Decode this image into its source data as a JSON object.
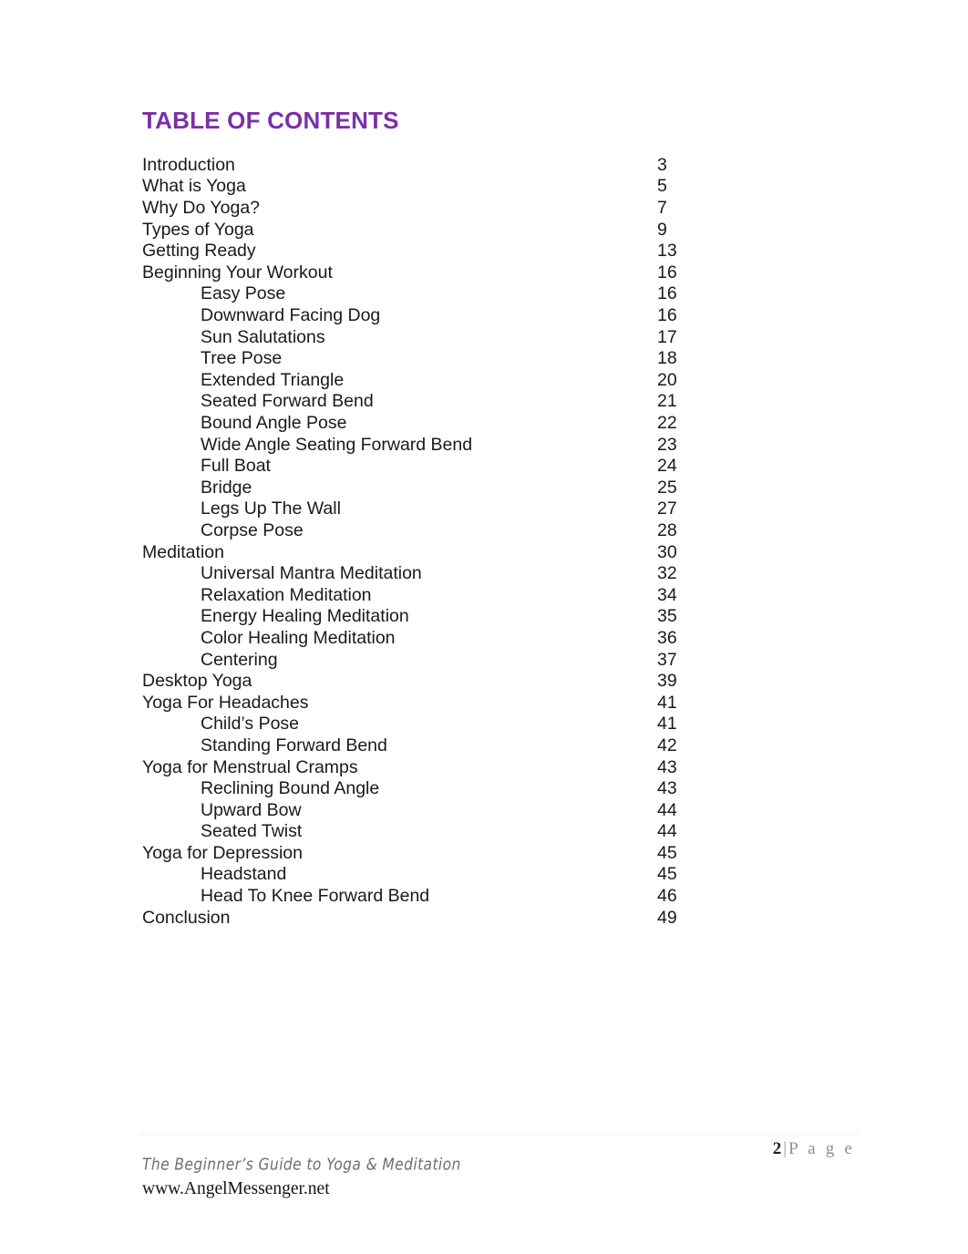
{
  "document": {
    "heading": "TABLE OF CONTENTS",
    "accent_color": "#7B2FA8"
  },
  "toc": {
    "entries": [
      {
        "title": "Introduction",
        "page": "3",
        "level": 0
      },
      {
        "title": "What is Yoga",
        "page": "5",
        "level": 0
      },
      {
        "title": "Why Do Yoga?",
        "page": "7",
        "level": 0
      },
      {
        "title": "Types of Yoga",
        "page": "9",
        "level": 0
      },
      {
        "title": "Getting Ready",
        "page": "13",
        "level": 0
      },
      {
        "title": "Beginning Your Workout",
        "page": "16",
        "level": 0
      },
      {
        "title": "Easy Pose",
        "page": "16",
        "level": 1
      },
      {
        "title": "Downward Facing Dog",
        "page": "16",
        "level": 1
      },
      {
        "title": "Sun Salutations",
        "page": "17",
        "level": 1
      },
      {
        "title": "Tree Pose",
        "page": "18",
        "level": 1
      },
      {
        "title": "Extended Triangle",
        "page": "20",
        "level": 1
      },
      {
        "title": "Seated Forward Bend",
        "page": "21",
        "level": 1
      },
      {
        "title": "Bound Angle Pose",
        "page": "22",
        "level": 1
      },
      {
        "title": "Wide Angle Seating Forward Bend",
        "page": "23",
        "level": 1
      },
      {
        "title": "Full Boat",
        "page": "24",
        "level": 1
      },
      {
        "title": "Bridge",
        "page": "25",
        "level": 1
      },
      {
        "title": "Legs Up The Wall",
        "page": "27",
        "level": 1
      },
      {
        "title": "Corpse Pose",
        "page": "28",
        "level": 1
      },
      {
        "title": "Meditation",
        "page": "30",
        "level": 0
      },
      {
        "title": "Universal Mantra Meditation",
        "page": "32",
        "level": 1
      },
      {
        "title": "Relaxation Meditation",
        "page": "34",
        "level": 1
      },
      {
        "title": "Energy Healing Meditation",
        "page": "35",
        "level": 1
      },
      {
        "title": "Color Healing Meditation",
        "page": "36",
        "level": 1
      },
      {
        "title": "Centering",
        "page": "37",
        "level": 1
      },
      {
        "title": "Desktop Yoga",
        "page": "39",
        "level": 0
      },
      {
        "title": "Yoga For Headaches",
        "page": "41",
        "level": 0
      },
      {
        "title": "Child’s Pose",
        "page": "41",
        "level": 1
      },
      {
        "title": "Standing Forward Bend",
        "page": "42",
        "level": 1
      },
      {
        "title": "Yoga for Menstrual Cramps",
        "page": "43",
        "level": 0
      },
      {
        "title": "Reclining Bound Angle",
        "page": "43",
        "level": 1
      },
      {
        "title": "Upward Bow",
        "page": "44",
        "level": 1
      },
      {
        "title": "Seated Twist",
        "page": "44",
        "level": 1
      },
      {
        "title": "Yoga for Depression",
        "page": "45",
        "level": 0
      },
      {
        "title": "Headstand",
        "page": "45",
        "level": 1
      },
      {
        "title": "Head To Knee Forward Bend",
        "page": "46",
        "level": 1
      },
      {
        "title": "Conclusion",
        "page": "49",
        "level": 0
      }
    ]
  },
  "footer": {
    "page_number": "2",
    "page_separator": "|",
    "page_word": "P a g e",
    "book_title": "The Beginner’s Guide to Yoga & Meditation",
    "website": "www.AngelMessenger.net"
  }
}
